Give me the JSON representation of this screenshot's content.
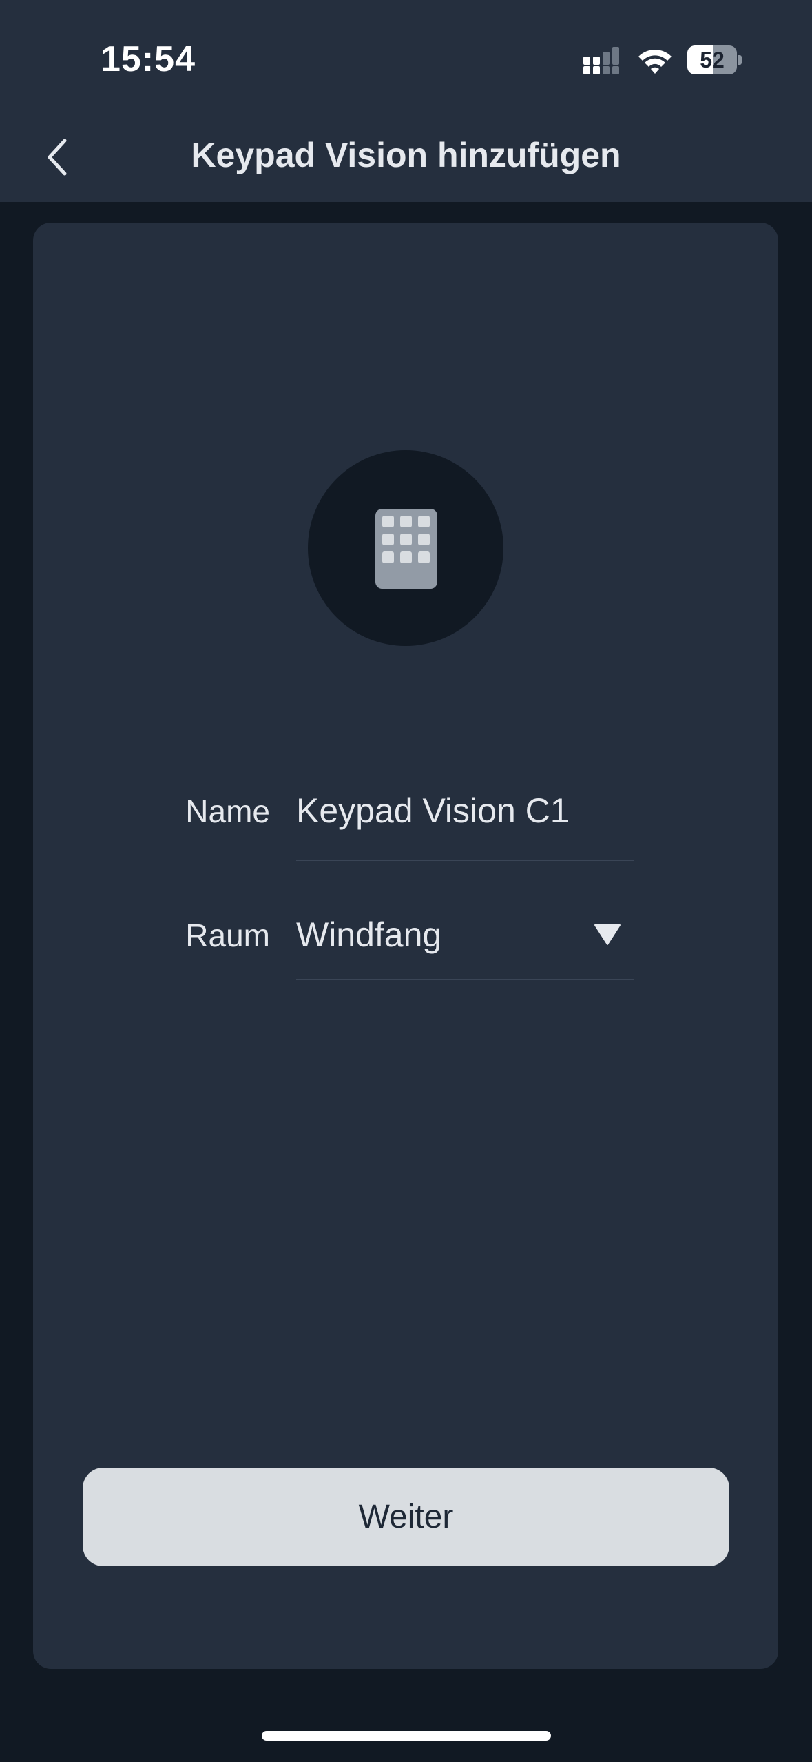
{
  "status_bar": {
    "time": "15:54",
    "battery_percent": "52",
    "battery_level": 0.52,
    "signal_icon": "cellular-signal-icon",
    "wifi_icon": "wifi-icon",
    "battery_icon": "battery-icon"
  },
  "header": {
    "title": "Keypad Vision hinzufügen",
    "back_icon": "chevron-left-icon"
  },
  "device": {
    "icon": "keypad-icon"
  },
  "form": {
    "name_label": "Name",
    "name_value": "Keypad Vision C1",
    "room_label": "Raum",
    "room_value": "Windfang",
    "dropdown_icon": "triangle-down-icon"
  },
  "actions": {
    "continue_label": "Weiter"
  },
  "colors": {
    "background": "#111923",
    "surface": "#252f3e",
    "button": "#d9dde1",
    "text": "#e6e9ee"
  }
}
